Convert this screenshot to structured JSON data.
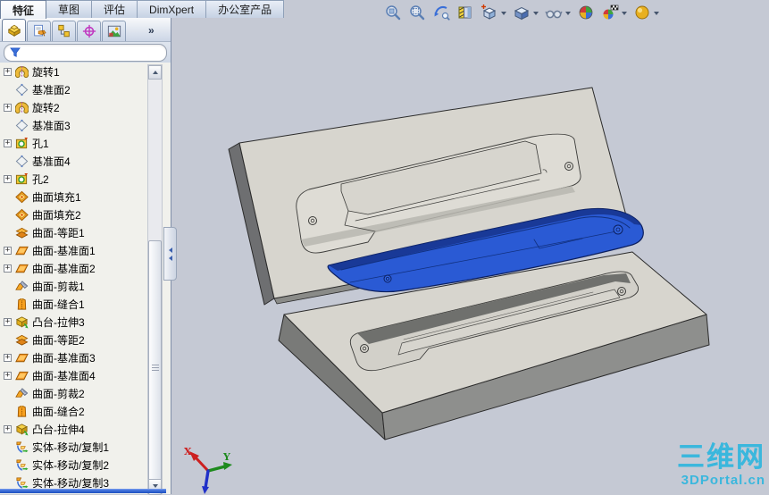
{
  "tab_strip": {
    "active": "特征",
    "tabs": [
      {
        "label": "特征"
      },
      {
        "label": "草图"
      },
      {
        "label": "评估"
      },
      {
        "label": "DimXpert"
      },
      {
        "label": "办公室产品"
      }
    ]
  },
  "headsup_toolbar": {
    "icons": [
      {
        "name": "zoom-fit",
        "dropdown": false
      },
      {
        "name": "zoom-area",
        "dropdown": false
      },
      {
        "name": "previous-view",
        "dropdown": false
      },
      {
        "name": "section-view",
        "dropdown": false
      },
      {
        "name": "view-orientation",
        "dropdown": true
      },
      {
        "name": "display-style",
        "dropdown": true
      },
      {
        "name": "hide-show-items",
        "dropdown": true
      },
      {
        "name": "edit-appearance",
        "dropdown": false
      },
      {
        "name": "apply-scene",
        "dropdown": true
      },
      {
        "name": "view-settings",
        "dropdown": true
      }
    ]
  },
  "feature_manager": {
    "panel_tabs": [
      "features",
      "properties",
      "configurations",
      "dimxpert",
      "display"
    ],
    "active_panel_tab": "features",
    "overflow_label": "»",
    "filter": {
      "value": "",
      "placeholder": ""
    },
    "tree_items": [
      {
        "label": "旋转1",
        "icon": "revolve",
        "expandable": true
      },
      {
        "label": "基准面2",
        "icon": "plane",
        "expandable": false
      },
      {
        "label": "旋转2",
        "icon": "revolve",
        "expandable": true
      },
      {
        "label": "基准面3",
        "icon": "plane",
        "expandable": false
      },
      {
        "label": "孔1",
        "icon": "hole",
        "expandable": true
      },
      {
        "label": "基准面4",
        "icon": "plane",
        "expandable": false
      },
      {
        "label": "孔2",
        "icon": "hole",
        "expandable": true
      },
      {
        "label": "曲面填充1",
        "icon": "surface-fill",
        "expandable": false
      },
      {
        "label": "曲面填充2",
        "icon": "surface-fill",
        "expandable": false
      },
      {
        "label": "曲面-等距1",
        "icon": "surface-offset",
        "expandable": false
      },
      {
        "label": "曲面-基准面1",
        "icon": "surface-plane",
        "expandable": true
      },
      {
        "label": "曲面-基准面2",
        "icon": "surface-plane",
        "expandable": true
      },
      {
        "label": "曲面-剪裁1",
        "icon": "surface-trim",
        "expandable": false
      },
      {
        "label": "曲面-缝合1",
        "icon": "surface-knit",
        "expandable": false
      },
      {
        "label": "凸台-拉伸3",
        "icon": "boss-extrude",
        "expandable": true
      },
      {
        "label": "曲面-等距2",
        "icon": "surface-offset",
        "expandable": false
      },
      {
        "label": "曲面-基准面3",
        "icon": "surface-plane",
        "expandable": true
      },
      {
        "label": "曲面-基准面4",
        "icon": "surface-plane",
        "expandable": true
      },
      {
        "label": "曲面-剪裁2",
        "icon": "surface-trim",
        "expandable": false
      },
      {
        "label": "曲面-缝合2",
        "icon": "surface-knit",
        "expandable": false
      },
      {
        "label": "凸台-拉伸4",
        "icon": "boss-extrude",
        "expandable": true
      },
      {
        "label": "实体-移动/复制1",
        "icon": "move-copy",
        "expandable": false
      },
      {
        "label": "实体-移动/复制2",
        "icon": "move-copy",
        "expandable": false
      },
      {
        "label": "实体-移动/复制3",
        "icon": "move-copy",
        "expandable": false
      }
    ]
  },
  "viewport": {
    "triad": {
      "x_label": "X",
      "y_label": "Y"
    },
    "watermark": {
      "title": "三维网",
      "subtitle": "3DPortal.cn"
    }
  },
  "colors": {
    "viewport_bg": "#c5c9d4",
    "part_blue": "#2a5ad4",
    "mold_gray": "#d7d5ce",
    "rollback_blue": "#2a5fd2",
    "watermark_cyan": "#2fb6de",
    "triad_x_red": "#cc2020",
    "triad_y_green": "#1e8a1e",
    "triad_z_blue": "#2030c8"
  }
}
